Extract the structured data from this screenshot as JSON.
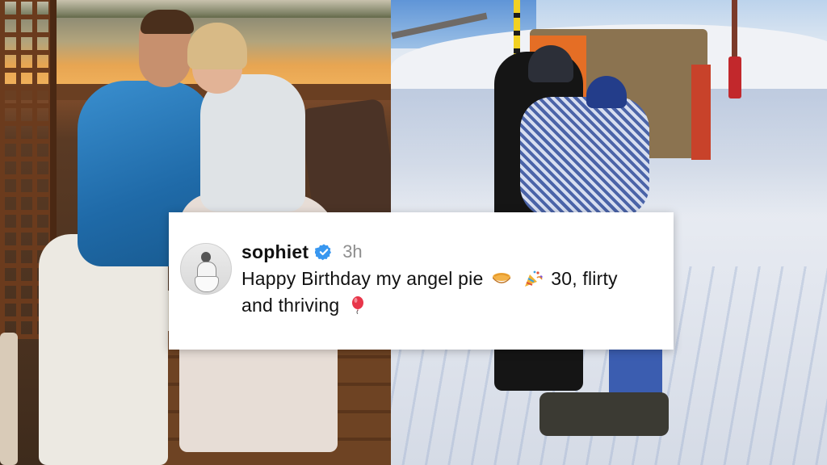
{
  "comment": {
    "username": "sophiet",
    "timestamp": "3h",
    "text_part1": "Happy Birthday my angel pie",
    "text_part2": "30, flirty and thriving",
    "emojis": [
      "pie-emoji",
      "party-popper-emoji",
      "balloon-emoji"
    ],
    "verified": true
  },
  "colors": {
    "verified_badge": "#3897f0",
    "username_text": "#111111",
    "timestamp_text": "#8e8e8e",
    "card_background": "#ffffff"
  },
  "photos": {
    "left": "couple-sunset-photo",
    "right": "couple-ski-slope-photo"
  }
}
